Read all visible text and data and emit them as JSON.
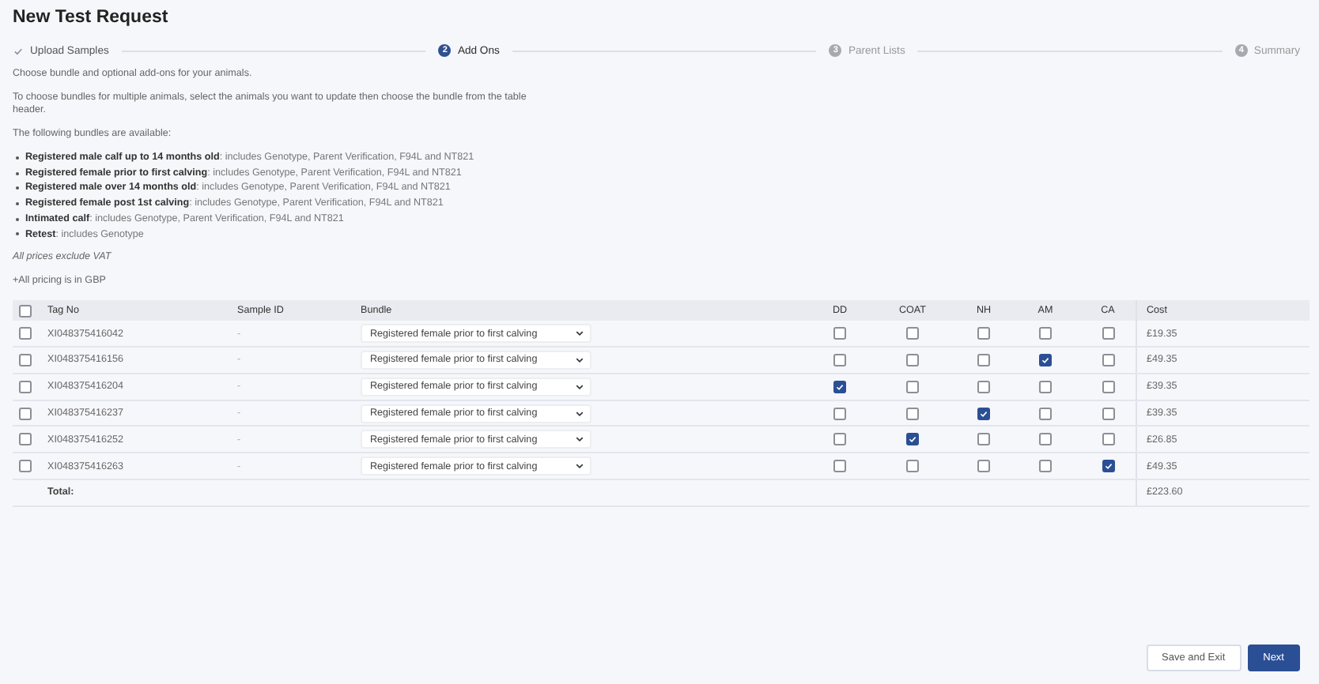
{
  "title": "New Test Request",
  "steps": [
    {
      "label": "Upload Samples",
      "completed": true,
      "selected": false
    },
    {
      "number": "2",
      "label": "Add Ons",
      "completed": false,
      "selected": true
    },
    {
      "number": "3",
      "label": "Parent Lists",
      "completed": false,
      "selected": false
    },
    {
      "number": "4",
      "label": "Summary",
      "completed": false,
      "selected": false
    }
  ],
  "intro": "Choose bundle and optional add-ons for your animals.",
  "instructions": "To choose bundles for multiple animals, select the animals you want to update then choose the bundle from the table header.",
  "bundles_heading": "The following bundles are available:",
  "bundles": [
    "**Registered male calf up to 14 months old**: includes Genotype, Parent Verification, F94L and NT821",
    "**Registered female prior to first calving**: includes Genotype, Parent Verification, F94L and NT821",
    "**Registered male over 14 months old**: includes Genotype, Parent Verification, F94L and NT821",
    "**Registered female post 1st calving**: includes Genotype, Parent Verification, F94L and NT821",
    "**Intimated calf**: includes Genotype, Parent Verification, F94L and NT821",
    "**Retest**: includes Genotype"
  ],
  "vat_note": "All prices exclude VAT",
  "currency_note": "+All pricing is in GBP",
  "table": {
    "select_all": false,
    "columns": {
      "tag": "Tag No",
      "sample": "Sample ID",
      "bundle": "Bundle",
      "addons": [
        "DD",
        "COAT",
        "NH",
        "AM",
        "CA"
      ],
      "cost": "Cost"
    },
    "rows": [
      {
        "selected": false,
        "tag": "XI048375416042",
        "sample_id": "-",
        "bundle": "Registered female prior to first calving",
        "addons": [
          false,
          false,
          false,
          false,
          false
        ],
        "cost": "£19.35"
      },
      {
        "selected": false,
        "tag": "XI048375416156",
        "sample_id": "-",
        "bundle": "Registered female prior to first calving",
        "addons": [
          false,
          false,
          false,
          true,
          false
        ],
        "cost": "£49.35"
      },
      {
        "selected": false,
        "tag": "XI048375416204",
        "sample_id": "-",
        "bundle": "Registered female prior to first calving",
        "addons": [
          true,
          false,
          false,
          false,
          false
        ],
        "cost": "£39.35"
      },
      {
        "selected": false,
        "tag": "XI048375416237",
        "sample_id": "-",
        "bundle": "Registered female prior to first calving",
        "addons": [
          false,
          false,
          true,
          false,
          false
        ],
        "cost": "£39.35"
      },
      {
        "selected": false,
        "tag": "XI048375416252",
        "sample_id": "-",
        "bundle": "Registered female prior to first calving",
        "addons": [
          false,
          true,
          false,
          false,
          false
        ],
        "cost": "£26.85"
      },
      {
        "selected": false,
        "tag": "XI048375416263",
        "sample_id": "-",
        "bundle": "Registered female prior to first calving",
        "addons": [
          false,
          false,
          false,
          false,
          true
        ],
        "cost": "£49.35"
      }
    ],
    "total_label": "Total:",
    "total": "£223.60"
  },
  "buttons": {
    "secondary": "Save and Exit",
    "primary": "Next"
  }
}
